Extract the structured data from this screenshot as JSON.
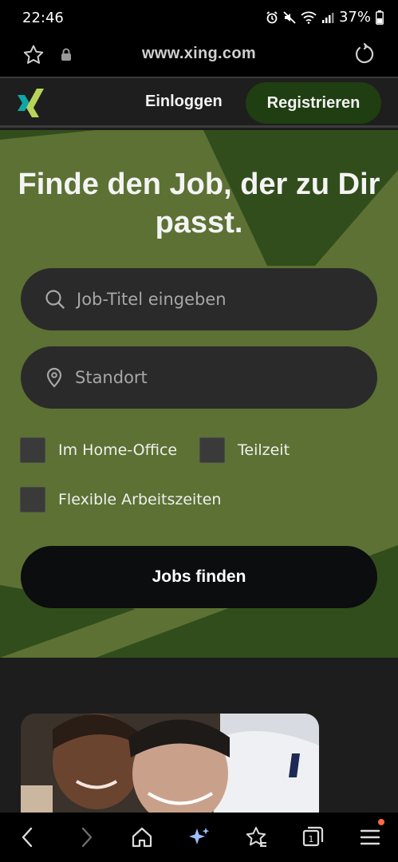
{
  "status_bar": {
    "time": "22:46",
    "battery": "37%"
  },
  "browser": {
    "url": "www.xing.com"
  },
  "header": {
    "login_label": "Einloggen",
    "register_label": "Registrieren"
  },
  "hero": {
    "headline": "Finde den Job, der zu Dir passt.",
    "job_placeholder": "Job-Titel eingeben",
    "location_placeholder": "Standort",
    "filters": [
      {
        "label": "Im Home-Office",
        "checked": false
      },
      {
        "label": "Teilzeit",
        "checked": false
      },
      {
        "label": "Flexible Arbeitszeiten",
        "checked": false
      }
    ],
    "search_button": "Jobs finden"
  },
  "colors": {
    "hero_green": "#5c7133",
    "dark_green_shape": "#324d1c",
    "register_bg": "#1f3e11",
    "logo_teal": "#0fa6a6",
    "logo_lime": "#b8d35a",
    "notification_dot": "#ff6a3c"
  },
  "bottom_nav": {
    "icons": [
      "back-icon",
      "forward-icon",
      "home-icon",
      "sparkle-icon",
      "bookmark-star-icon",
      "tabs-icon",
      "menu-icon"
    ],
    "tabs_count": "1"
  }
}
